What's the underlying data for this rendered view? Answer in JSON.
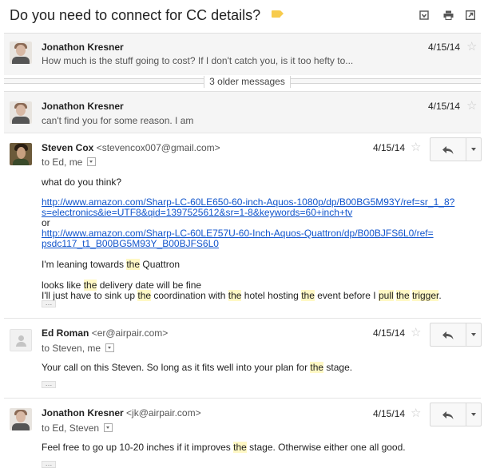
{
  "thread": {
    "subject": "Do you need to connect for CC details?",
    "label_color": "#f7cb4d",
    "icons": [
      "expand-all-icon",
      "print-icon",
      "open-new-window-icon"
    ]
  },
  "collapsed": [
    {
      "sender": "Jonathon Kresner",
      "snippet": "How much is the stuff going to cost? If I don't catch you, is it too hefty to...",
      "date": "4/15/14"
    },
    {
      "sender": "Jonathon Kresner",
      "snippet": "can't find you for some reason. I am",
      "date": "4/15/14"
    }
  ],
  "older_messages": "3 older messages",
  "messages": [
    {
      "sender": "Steven Cox",
      "email": "<stevencox007@gmail.com>",
      "to": "to Ed, me",
      "date": "4/15/14",
      "body": {
        "line1": "what do you think?",
        "link1a": "http://www.amazon.com/Sharp-LC-60LE650-60-inch-Aquos-1080p/dp/B00BG5M93Y/ref=sr_1_8?",
        "link1b": "s=electronics&ie=UTF8&qid=1397525612&sr=1-8&keywords=60+inch+tv",
        "or": "or",
        "link2a": "http://www.amazon.com/Sharp-LC-60LE757U-60-Inch-Aquos-Quattron/dp/B00BJFS6L0/ref=",
        "link2b": "psdc117_t1_B00BG5M93Y_B00BJFS6L0",
        "lean_pre": "I'm leaning towards ",
        "the": "the",
        "lean_post": " Quattron",
        "look_pre": "looks like ",
        "look_post": " delivery date will be fine",
        "sink_1": "I'll just have to sink up ",
        "sink_2": " coordination with ",
        "sink_3": " hotel hosting ",
        "sink_4": " event before I ",
        "pull": "pull",
        "trigger": "trigger",
        "dot": "."
      }
    },
    {
      "sender": "Ed Roman",
      "email": "<er@airpair.com>",
      "to": "to Steven, me",
      "date": "4/15/14",
      "body": {
        "pre": "Your call on this Steven.  So long as it fits well into your plan for ",
        "the": "the",
        "post": " stage."
      }
    },
    {
      "sender": "Jonathon Kresner",
      "email": "<jk@airpair.com>",
      "to": "to Ed, Steven",
      "date": "4/15/14",
      "body": {
        "pre": "Feel free to go up 10-20 inches if it improves ",
        "the": "the",
        "post": " stage. Otherwise either one all good."
      }
    }
  ],
  "ellipsis_label": "…",
  "colors": {
    "link": "#1155cc",
    "highlight": "#fff8c4",
    "collapsed_bg": "#f5f5f5"
  }
}
